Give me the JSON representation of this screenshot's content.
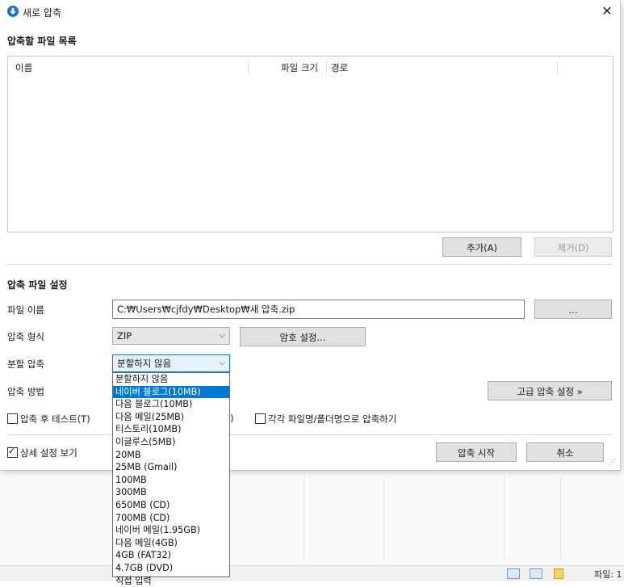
{
  "window": {
    "title": "새로 압축",
    "close_glyph": "✕"
  },
  "file_list": {
    "heading": "압축할 파일 목록",
    "columns": {
      "name": "이름",
      "size": "파일 크기",
      "path": "경로"
    }
  },
  "buttons": {
    "add": "추가(A)",
    "remove": "제거(D)",
    "browse": "...",
    "password": "암호 설정...",
    "advanced": "고급 압축 설정 »",
    "start": "압축 시작",
    "cancel": "취소"
  },
  "settings": {
    "heading": "압축 파일 설정",
    "filename_label": "파일 이름",
    "filename_value": "C:₩Users₩cjfdy₩Desktop₩새 압축.zip",
    "format_label": "압축 형식",
    "format_value": "ZIP",
    "split_label": "분할 압축",
    "split_value": "분할하지 않음",
    "method_label": "압축 방법"
  },
  "checks": {
    "test_after": {
      "label": "압축 후 테스트(T)",
      "checked": false
    },
    "each_file": {
      "label": "각각 파일명/폴더명으로 압축하기",
      "checked": false
    },
    "show_details": {
      "label": "상세 설정 보기",
      "checked": true
    },
    "hidden_fragment": ")"
  },
  "split_options": [
    "분할하지 않음",
    "네이버 블로그(10MB)",
    "다음 블로그(10MB)",
    "다음 메일(25MB)",
    "티스토리(10MB)",
    "이글루스(5MB)",
    "20MB",
    "25MB (Gmail)",
    "100MB",
    "300MB",
    "650MB (CD)",
    "700MB (CD)",
    "네이버 메일(1.95GB)",
    "다음 메일(4GB)",
    "4GB (FAT32)",
    "4.7GB (DVD)",
    "직접 입력"
  ],
  "split_highlighted_index": 1,
  "background": {
    "status_text": "파일: 1"
  },
  "colors": {
    "accent": "#0078d7",
    "icon_blue": "#1e6ed6"
  }
}
